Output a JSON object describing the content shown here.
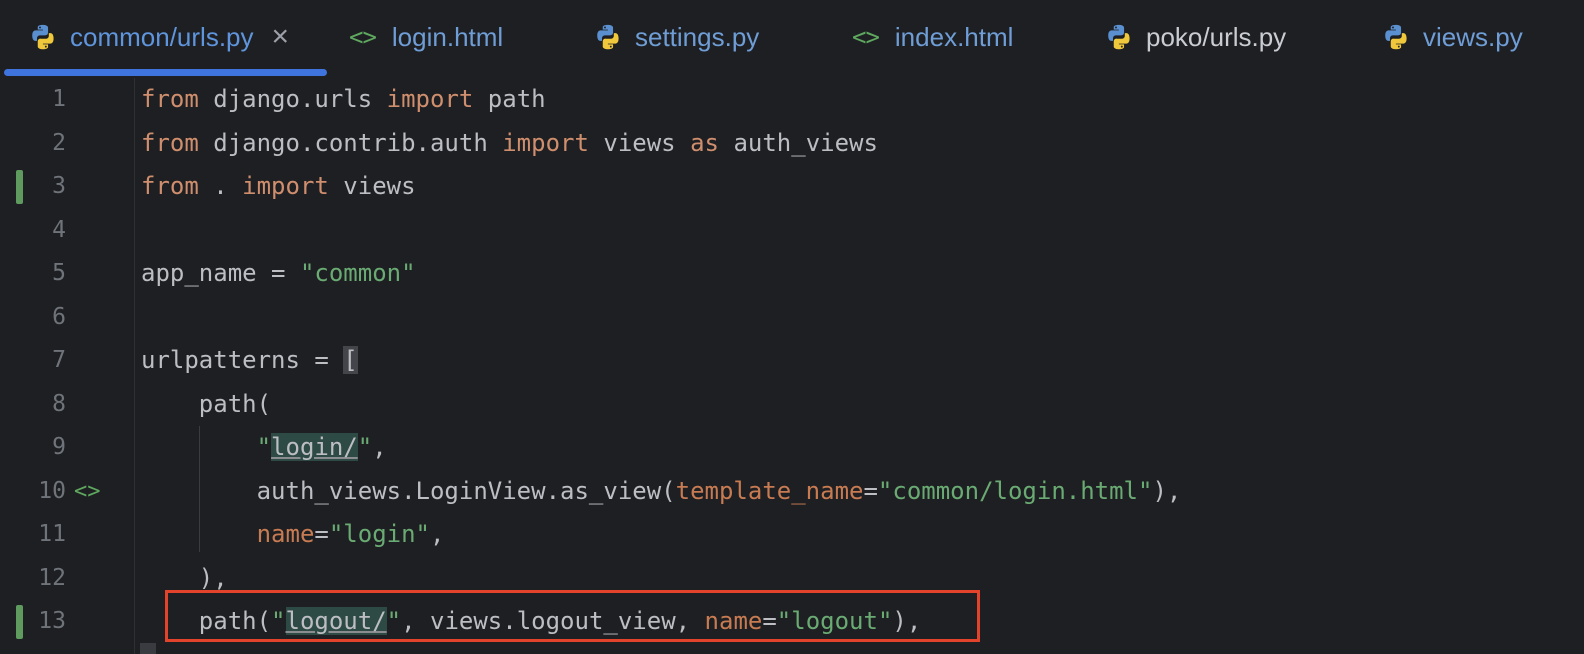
{
  "tabs": [
    {
      "label": "common/urls.py",
      "icon": "python-icon",
      "active": true,
      "close": "×"
    },
    {
      "label": "login.html",
      "icon": "html-icon",
      "icon_glyph": "<>"
    },
    {
      "label": "settings.py",
      "icon": "python-icon"
    },
    {
      "label": "index.html",
      "icon": "html-icon",
      "icon_glyph": "<>"
    },
    {
      "label": "poko/urls.py",
      "icon": "python-icon"
    },
    {
      "label": "views.py",
      "icon": "python-icon"
    }
  ],
  "editor": {
    "line_numbers": [
      "1",
      "2",
      "3",
      "4",
      "5",
      "6",
      "7",
      "8",
      "9",
      "10",
      "11",
      "12",
      "13"
    ],
    "gutter_icon_line_10": "<>",
    "changed_lines": [
      3,
      13
    ],
    "lines": [
      "from django.urls import path",
      "from django.contrib.auth import views as auth_views",
      "from . import views",
      "",
      "app_name = \"common\"",
      "",
      "urlpatterns = [",
      "    path(",
      "        \"login/\",",
      "        auth_views.LoginView.as_view(template_name=\"common/login.html\"),",
      "        name=\"login\",",
      "    ),",
      "    path(\"logout/\", views.logout_view, name=\"logout\"),"
    ]
  },
  "colors": {
    "background": "#1e1f22",
    "keyword": "#cf8e6d",
    "string": "#6aab73",
    "param": "#c77b52",
    "tab_active_underline": "#3f74df",
    "highlight_box": "#e3432a"
  }
}
